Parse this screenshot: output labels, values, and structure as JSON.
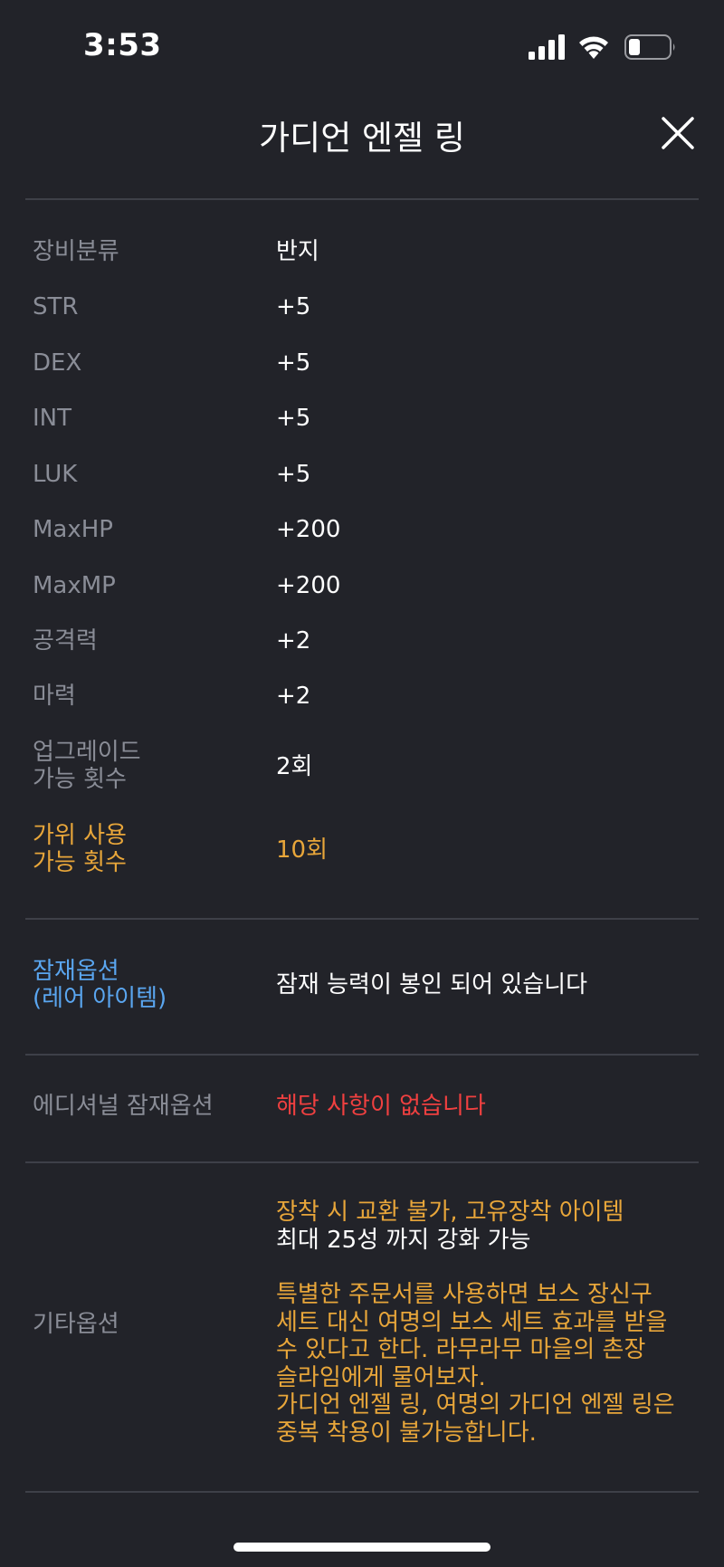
{
  "status_bar": {
    "time": "3:53"
  },
  "header": {
    "title": "가디언 엔젤 링"
  },
  "stats": [
    {
      "label": "장비분류",
      "value": "반지"
    },
    {
      "label": "STR",
      "value": "+5"
    },
    {
      "label": "DEX",
      "value": "+5"
    },
    {
      "label": "INT",
      "value": "+5"
    },
    {
      "label": "LUK",
      "value": "+5"
    },
    {
      "label": "MaxHP",
      "value": "+200"
    },
    {
      "label": "MaxMP",
      "value": "+200"
    },
    {
      "label": "공격력",
      "value": "+2"
    },
    {
      "label": "마력",
      "value": "+2"
    }
  ],
  "upgrade": {
    "label_line1": "업그레이드",
    "label_line2": "가능 횟수",
    "value": "2회"
  },
  "scissors": {
    "label_line1": "가위 사용",
    "label_line2": "가능 횟수",
    "value": "10회"
  },
  "potential": {
    "label_line1": "잠재옵션",
    "label_line2": "(레어 아이템)",
    "value": "잠재 능력이 봉인 되어 있습니다"
  },
  "additional_potential": {
    "label": "에디셔널 잠재옵션",
    "value": "해당 사항이 없습니다"
  },
  "etc": {
    "label": "기타옵션",
    "line1": "장착 시 교환 불가, 고유장착 아이템",
    "line2": "최대 25성 까지 강화 가능",
    "desc_lines": [
      "특별한 주문서를 사용하면 보스 장신구",
      "세트 대신 여명의 보스 세트 효과를 받을",
      "수 있다고 한다. 라무라무 마을의 촌장",
      "슬라임에게 물어보자.",
      "가디언 엔젤 링, 여명의 가디언 엔젤 링은",
      "중복 착용이 불가능합니다."
    ]
  },
  "colors": {
    "background": "#222329",
    "label_gray": "#8a8d97",
    "orange": "#e8a63a",
    "blue": "#5aa6f0",
    "red": "#f04040",
    "divider": "#3e4048"
  },
  "icons": [
    "signal-icon",
    "wifi-icon",
    "battery-icon",
    "close-icon"
  ]
}
